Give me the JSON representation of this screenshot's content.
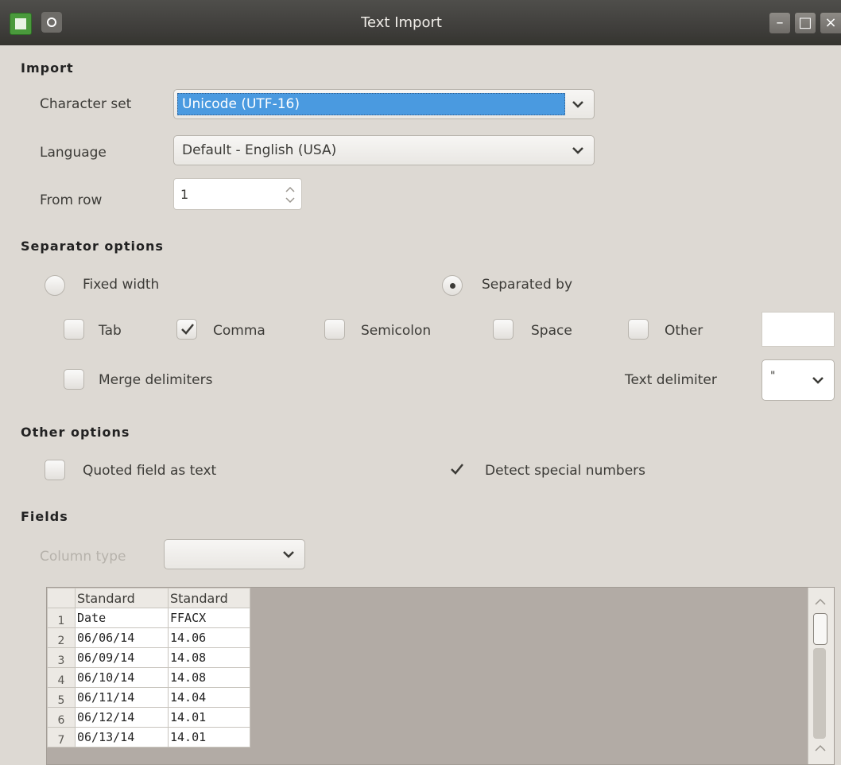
{
  "window": {
    "title": "Text Import"
  },
  "import": {
    "section": "Import",
    "charset_label": "Character set",
    "charset_value": "Unicode (UTF-16)",
    "language_label": "Language",
    "language_value": "Default - English (USA)",
    "from_row_label": "From row",
    "from_row_value": "1"
  },
  "separator": {
    "section": "Separator options",
    "fixed_width": "Fixed width",
    "separated_by": "Separated by",
    "tab": "Tab",
    "comma": "Comma",
    "semicolon": "Semicolon",
    "space": "Space",
    "other": "Other",
    "merge": "Merge delimiters",
    "text_delimiter_label": "Text delimiter",
    "text_delimiter_value": "\"",
    "selected_mode": "separated_by",
    "checked": [
      "comma"
    ]
  },
  "other": {
    "section": "Other options",
    "quoted": "Quoted field as text",
    "detect": "Detect special numbers"
  },
  "fields": {
    "section": "Fields",
    "column_type_label": "Column type",
    "column_type_value": "",
    "headers": [
      "Standard",
      "Standard"
    ],
    "rows": [
      {
        "n": "1",
        "a": "Date",
        "b": "FFACX"
      },
      {
        "n": "2",
        "a": "06/06/14",
        "b": "14.06"
      },
      {
        "n": "3",
        "a": "06/09/14",
        "b": "14.08"
      },
      {
        "n": "4",
        "a": "06/10/14",
        "b": "14.08"
      },
      {
        "n": "5",
        "a": "06/11/14",
        "b": "14.04"
      },
      {
        "n": "6",
        "a": "06/12/14",
        "b": "14.01"
      },
      {
        "n": "7",
        "a": "06/13/14",
        "b": "14.01"
      }
    ]
  },
  "icons": {
    "app": "spreadsheet-app-icon",
    "window_menu": "window-menu-icon",
    "minimize": "minimize-icon",
    "maximize": "maximize-icon",
    "close": "close-icon"
  },
  "colors": {
    "accent": "#4a9ae0",
    "titlebar": "#3d3c39",
    "background": "#ddd9d3"
  }
}
